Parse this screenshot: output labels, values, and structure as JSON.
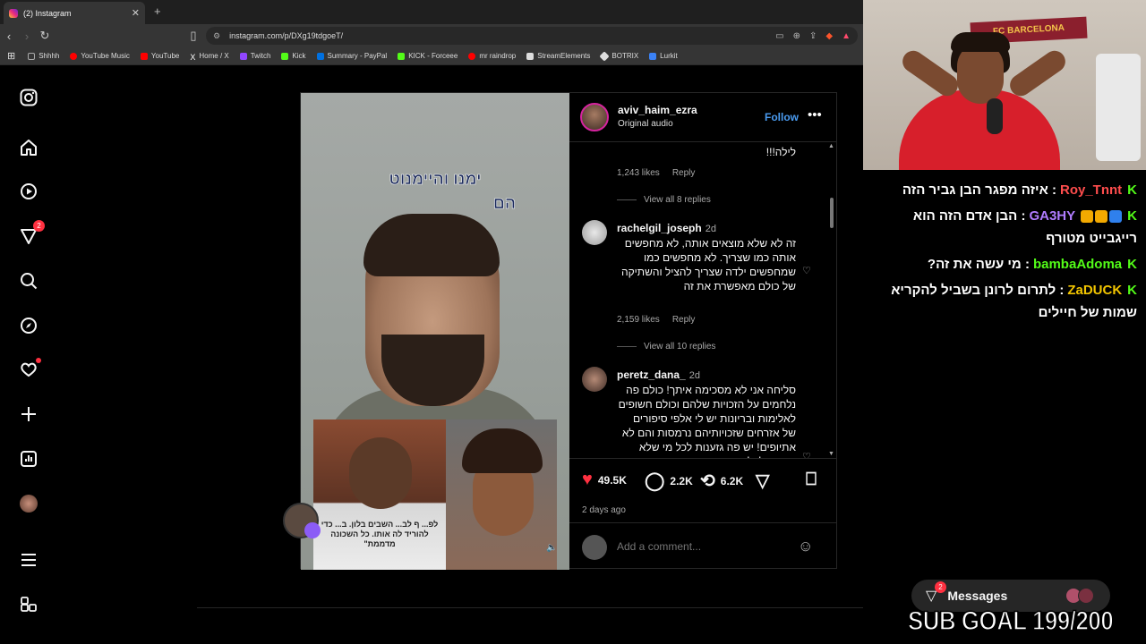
{
  "browser": {
    "tab_title": "(2) Instagram",
    "url": "instagram.com/p/DXg19tdgoeT/",
    "bookmarks": [
      {
        "label": "Shhhh",
        "color": "#aaaaaa"
      },
      {
        "label": "YouTube Music",
        "color": "#ff0000"
      },
      {
        "label": "YouTube",
        "color": "#ff0000"
      },
      {
        "label": "Home / X",
        "color": "#ffffff"
      },
      {
        "label": "Twitch",
        "color": "#9146ff"
      },
      {
        "label": "Kick",
        "color": "#53fc18"
      },
      {
        "label": "Summary - PayPal",
        "color": "#0070e0"
      },
      {
        "label": "KICK - Forceee",
        "color": "#53fc18"
      },
      {
        "label": "mr raindrop",
        "color": "#ff0000"
      },
      {
        "label": "StreamElements",
        "color": "#dddddd"
      },
      {
        "label": "BOTRIX",
        "color": "#dddddd"
      },
      {
        "label": "Lurkit",
        "color": "#3b82f6"
      }
    ]
  },
  "nav": {
    "notifications_badge": "2"
  },
  "post": {
    "username": "aviv_haim_ezra",
    "audio": "Original audio",
    "follow_label": "Follow",
    "video_caption_line1": "ימנו והיימנוט",
    "video_caption_line2": "הם",
    "inset_text": "לפ... ף לב... השבים בלון. ב... כדי להוריד לה אותו. כל השכונה מדממת\"",
    "comments": [
      {
        "text_top": "לילה!!!",
        "likes": "1,243 likes",
        "reply": "Reply",
        "view_replies": "View all 8 replies"
      },
      {
        "user": "rachelgil_joseph",
        "time": "2d",
        "text": "זה לא שלא מוצאים אותה, לא מחפשים אותה כמו שצריך. לא מחפשים כמו שמחפשים ילדה שצריך להציל והשתיקה של כולם מאפשרת את זה",
        "likes": "2,159 likes",
        "reply": "Reply",
        "view_replies": "View all 10 replies"
      },
      {
        "user": "peretz_dana_",
        "time": "2d",
        "text": "סליחה אני לא מסכימה איתך! כולם פה נלחמים על הזכויות שלהם וכולם חשופים לאלימות ובריונות יש לי אלפי סיפורים של אזרחים שזכויותיהם נרמסות והם לא אתיופים! יש פה גזענות לכל מי שלא מקורב לצלחת איו"
      }
    ],
    "stats": {
      "likes": "49.5K",
      "comments": "2.2K",
      "reposts": "6.2K"
    },
    "date": "2 days ago",
    "add_comment_placeholder": "Add a comment..."
  },
  "stream": {
    "banner": "FC BARCELONA",
    "chat": [
      {
        "user": "Roy_Tnnt",
        "user_color": "#ff4d4d",
        "msg": ": איזה מפגר הבן גביר הזה"
      },
      {
        "user": "GA3HY",
        "user_color": "#b07cff",
        "msg": ": הבן אדם הזה הוא רייגבייט מטורף",
        "badges": [
          "#2f80ed",
          "#f2a900",
          "#f2a900"
        ]
      },
      {
        "user": "bambaAdoma",
        "user_color": "#53fc18",
        "msg": ": מי עשה את זה?"
      },
      {
        "user": "ZaDUCK",
        "user_color": "#f2c500",
        "msg": ": לתרום לרונן בשביל להקריא שמות של חיילים"
      }
    ],
    "messages_label": "Messages",
    "messages_badge": "2",
    "sub_goal": "SUB GOAL 199/200"
  }
}
